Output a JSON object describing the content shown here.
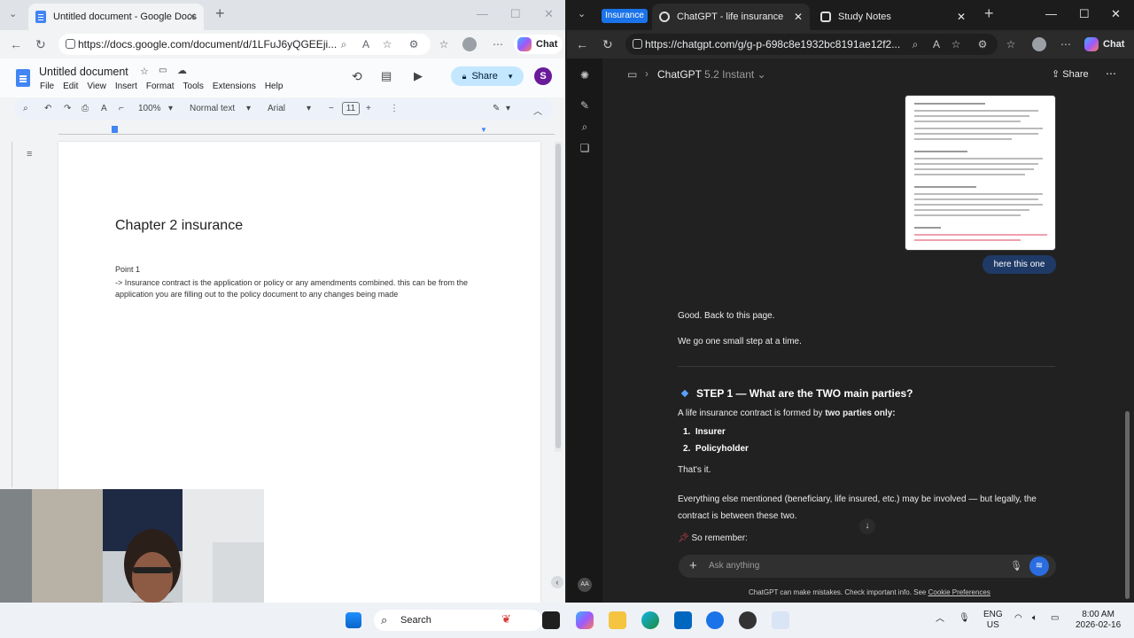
{
  "left_browser": {
    "tab_title": "Untitled document - Google Docs",
    "url": "https://docs.google.com/document/d/1LFuJ6yQGEEji...",
    "chat_label": "Chat"
  },
  "docs": {
    "title": "Untitled document",
    "menus": [
      "File",
      "Edit",
      "View",
      "Insert",
      "Format",
      "Tools",
      "Extensions",
      "Help"
    ],
    "share_label": "Share",
    "avatar_letter": "S",
    "toolbar": {
      "zoom": "100%",
      "style": "Normal text",
      "font": "Arial",
      "size": "11"
    },
    "content": {
      "heading": "Chapter 2 insurance",
      "point_label": "Point 1",
      "body": "-> Insurance contract is the application or policy or any amendments combined. this can be from the application you are filling out to the policy document to any changes being made"
    }
  },
  "right_browser": {
    "group_tag": "Insurance",
    "tabs": [
      "ChatGPT - life insurance",
      "Study Notes"
    ],
    "url": "https://chatgpt.com/g/g-p-698c8e1932bc8191ae12f2...",
    "chat_label": "Chat"
  },
  "chatgpt": {
    "model_name": "ChatGPT",
    "model_version": "5.2 Instant",
    "share_label": "Share",
    "user_message": "here this one",
    "reply_line1": "Good. Back to this page.",
    "reply_line2": "We go one small step at a time.",
    "step_heading": "STEP 1 — What are the TWO main parties?",
    "intro_before": "A life insurance contract is formed by ",
    "intro_bold": "two parties only:",
    "parties": [
      "Insurer",
      "Policyholder"
    ],
    "thats_it": "That's it.",
    "everything_else": "Everything else mentioned (beneficiary, life insured, etc.) may be involved — but legally, the contract is between these two.",
    "remember": "So remember:",
    "input_placeholder": "Ask anything",
    "disclaimer_text": "ChatGPT can make mistakes. Check important info. See ",
    "disclaimer_link": "Cookie Preferences"
  },
  "taskbar": {
    "search_label": "Search",
    "lang_top": "ENG",
    "lang_bottom": "US",
    "time": "8:00 AM",
    "date": "2026-02-16"
  }
}
